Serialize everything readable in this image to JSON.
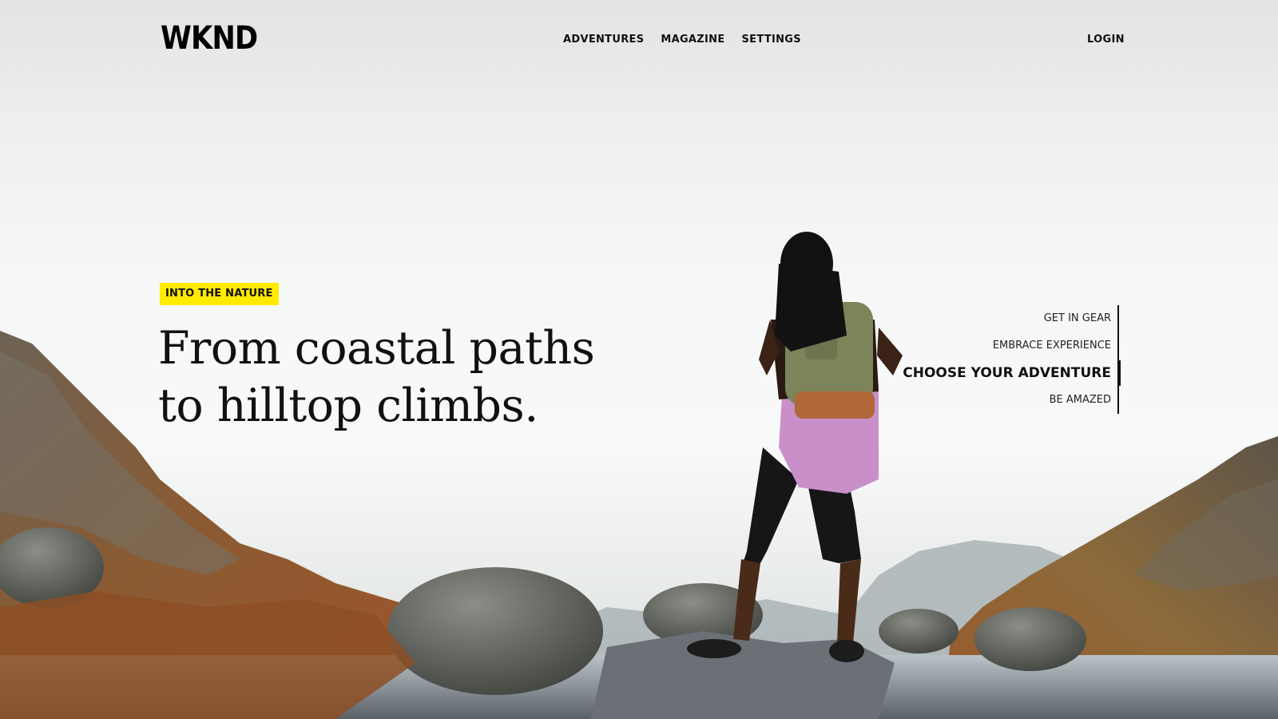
{
  "header": {
    "logo": "WKND",
    "nav": [
      "ADVENTURES",
      "MAGAZINE",
      "SETTINGS"
    ],
    "login": "LOGIN"
  },
  "hero": {
    "badge": "INTO THE NATURE",
    "headline_line1": "From coastal paths",
    "headline_line2": "to hilltop climbs.",
    "slides": [
      "GET IN GEAR",
      "EMBRACE EXPERIENCE",
      "CHOOSE YOUR ADVENTURE",
      "BE AMAZED"
    ],
    "active_slide": 2
  },
  "colors": {
    "accent": "#ffea00",
    "text": "#111111"
  }
}
